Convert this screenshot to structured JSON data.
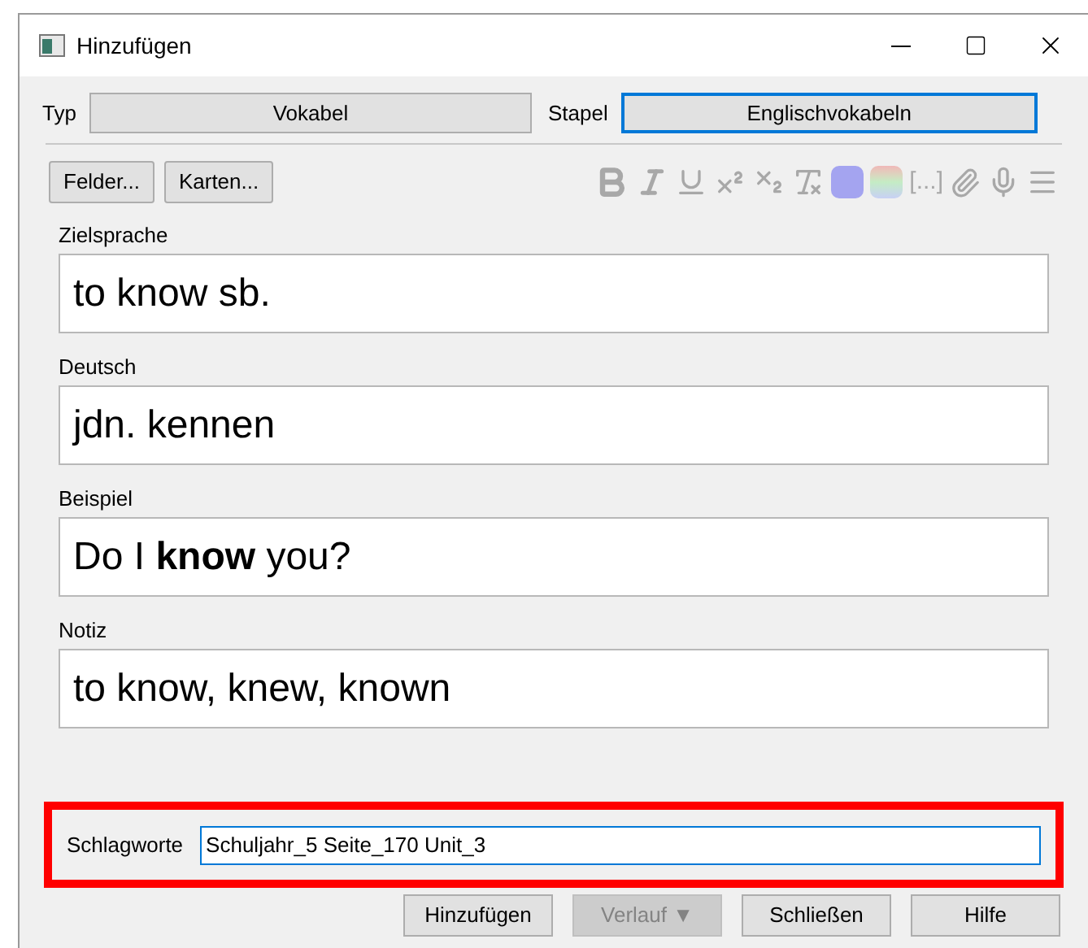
{
  "window": {
    "title": "Hinzufügen"
  },
  "type_row": [
    {
      "label": "Typ",
      "value": "Vokabel",
      "focused": false
    },
    {
      "label": "Stapel",
      "value": "Englischvokabeln",
      "focused": true
    }
  ],
  "buttons_top": [
    "Felder...",
    "Karten..."
  ],
  "toolbar": {
    "cloze_label": "[...]"
  },
  "fields": [
    {
      "label": "Zielsprache",
      "value": "to know sb."
    },
    {
      "label": "Deutsch",
      "value": "jdn. kennen"
    },
    {
      "label": "Beispiel",
      "value": "Do I **know** you?"
    },
    {
      "label": "Notiz",
      "value": "to know, knew, known"
    }
  ],
  "tags": {
    "label": "Schlagworte",
    "value": "Schuljahr_5 Seite_170 Unit_3",
    "highlighted": true
  },
  "buttons_bottom": [
    {
      "label": "Hinzufügen",
      "disabled": false
    },
    {
      "label": "Verlauf ▼",
      "disabled": true
    },
    {
      "label": "Schließen",
      "disabled": false
    },
    {
      "label": "Hilfe",
      "disabled": false
    }
  ]
}
